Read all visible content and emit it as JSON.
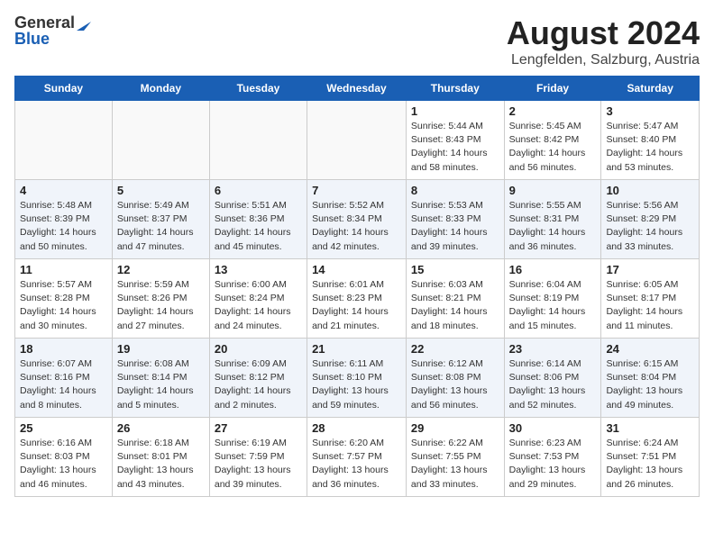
{
  "logo": {
    "general": "General",
    "blue": "Blue"
  },
  "title": "August 2024",
  "subtitle": "Lengfelden, Salzburg, Austria",
  "headers": [
    "Sunday",
    "Monday",
    "Tuesday",
    "Wednesday",
    "Thursday",
    "Friday",
    "Saturday"
  ],
  "weeks": [
    [
      {
        "day": "",
        "info": ""
      },
      {
        "day": "",
        "info": ""
      },
      {
        "day": "",
        "info": ""
      },
      {
        "day": "",
        "info": ""
      },
      {
        "day": "1",
        "info": "Sunrise: 5:44 AM\nSunset: 8:43 PM\nDaylight: 14 hours\nand 58 minutes."
      },
      {
        "day": "2",
        "info": "Sunrise: 5:45 AM\nSunset: 8:42 PM\nDaylight: 14 hours\nand 56 minutes."
      },
      {
        "day": "3",
        "info": "Sunrise: 5:47 AM\nSunset: 8:40 PM\nDaylight: 14 hours\nand 53 minutes."
      }
    ],
    [
      {
        "day": "4",
        "info": "Sunrise: 5:48 AM\nSunset: 8:39 PM\nDaylight: 14 hours\nand 50 minutes."
      },
      {
        "day": "5",
        "info": "Sunrise: 5:49 AM\nSunset: 8:37 PM\nDaylight: 14 hours\nand 47 minutes."
      },
      {
        "day": "6",
        "info": "Sunrise: 5:51 AM\nSunset: 8:36 PM\nDaylight: 14 hours\nand 45 minutes."
      },
      {
        "day": "7",
        "info": "Sunrise: 5:52 AM\nSunset: 8:34 PM\nDaylight: 14 hours\nand 42 minutes."
      },
      {
        "day": "8",
        "info": "Sunrise: 5:53 AM\nSunset: 8:33 PM\nDaylight: 14 hours\nand 39 minutes."
      },
      {
        "day": "9",
        "info": "Sunrise: 5:55 AM\nSunset: 8:31 PM\nDaylight: 14 hours\nand 36 minutes."
      },
      {
        "day": "10",
        "info": "Sunrise: 5:56 AM\nSunset: 8:29 PM\nDaylight: 14 hours\nand 33 minutes."
      }
    ],
    [
      {
        "day": "11",
        "info": "Sunrise: 5:57 AM\nSunset: 8:28 PM\nDaylight: 14 hours\nand 30 minutes."
      },
      {
        "day": "12",
        "info": "Sunrise: 5:59 AM\nSunset: 8:26 PM\nDaylight: 14 hours\nand 27 minutes."
      },
      {
        "day": "13",
        "info": "Sunrise: 6:00 AM\nSunset: 8:24 PM\nDaylight: 14 hours\nand 24 minutes."
      },
      {
        "day": "14",
        "info": "Sunrise: 6:01 AM\nSunset: 8:23 PM\nDaylight: 14 hours\nand 21 minutes."
      },
      {
        "day": "15",
        "info": "Sunrise: 6:03 AM\nSunset: 8:21 PM\nDaylight: 14 hours\nand 18 minutes."
      },
      {
        "day": "16",
        "info": "Sunrise: 6:04 AM\nSunset: 8:19 PM\nDaylight: 14 hours\nand 15 minutes."
      },
      {
        "day": "17",
        "info": "Sunrise: 6:05 AM\nSunset: 8:17 PM\nDaylight: 14 hours\nand 11 minutes."
      }
    ],
    [
      {
        "day": "18",
        "info": "Sunrise: 6:07 AM\nSunset: 8:16 PM\nDaylight: 14 hours\nand 8 minutes."
      },
      {
        "day": "19",
        "info": "Sunrise: 6:08 AM\nSunset: 8:14 PM\nDaylight: 14 hours\nand 5 minutes."
      },
      {
        "day": "20",
        "info": "Sunrise: 6:09 AM\nSunset: 8:12 PM\nDaylight: 14 hours\nand 2 minutes."
      },
      {
        "day": "21",
        "info": "Sunrise: 6:11 AM\nSunset: 8:10 PM\nDaylight: 13 hours\nand 59 minutes."
      },
      {
        "day": "22",
        "info": "Sunrise: 6:12 AM\nSunset: 8:08 PM\nDaylight: 13 hours\nand 56 minutes."
      },
      {
        "day": "23",
        "info": "Sunrise: 6:14 AM\nSunset: 8:06 PM\nDaylight: 13 hours\nand 52 minutes."
      },
      {
        "day": "24",
        "info": "Sunrise: 6:15 AM\nSunset: 8:04 PM\nDaylight: 13 hours\nand 49 minutes."
      }
    ],
    [
      {
        "day": "25",
        "info": "Sunrise: 6:16 AM\nSunset: 8:03 PM\nDaylight: 13 hours\nand 46 minutes."
      },
      {
        "day": "26",
        "info": "Sunrise: 6:18 AM\nSunset: 8:01 PM\nDaylight: 13 hours\nand 43 minutes."
      },
      {
        "day": "27",
        "info": "Sunrise: 6:19 AM\nSunset: 7:59 PM\nDaylight: 13 hours\nand 39 minutes."
      },
      {
        "day": "28",
        "info": "Sunrise: 6:20 AM\nSunset: 7:57 PM\nDaylight: 13 hours\nand 36 minutes."
      },
      {
        "day": "29",
        "info": "Sunrise: 6:22 AM\nSunset: 7:55 PM\nDaylight: 13 hours\nand 33 minutes."
      },
      {
        "day": "30",
        "info": "Sunrise: 6:23 AM\nSunset: 7:53 PM\nDaylight: 13 hours\nand 29 minutes."
      },
      {
        "day": "31",
        "info": "Sunrise: 6:24 AM\nSunset: 7:51 PM\nDaylight: 13 hours\nand 26 minutes."
      }
    ]
  ]
}
